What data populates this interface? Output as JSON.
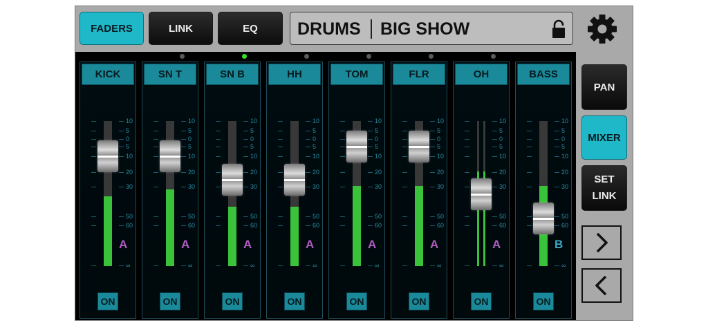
{
  "topbar": {
    "tabs": [
      {
        "label": "FADERS",
        "active": true
      },
      {
        "label": "LINK",
        "active": false
      },
      {
        "label": "EQ",
        "active": false
      }
    ],
    "group_name": "DRUMS",
    "show_name": "BIG SHOW"
  },
  "scale_labels": [
    "10",
    "5",
    "0",
    "5",
    "10",
    "20",
    "30",
    "50",
    "60",
    "∞"
  ],
  "channels": [
    {
      "name": "KICK",
      "group": "A",
      "on_label": "ON",
      "fader_db": -10,
      "meter": 0.48,
      "selected": false,
      "stereo": false
    },
    {
      "name": "SN T",
      "group": "A",
      "on_label": "ON",
      "fader_db": -10,
      "meter": 0.53,
      "selected": true,
      "stereo": false
    },
    {
      "name": "SN B",
      "group": "A",
      "on_label": "ON",
      "fader_db": -25,
      "meter": 0.41,
      "selected": false,
      "stereo": false
    },
    {
      "name": "HH",
      "group": "A",
      "on_label": "ON",
      "fader_db": -25,
      "meter": 0.41,
      "selected": false,
      "stereo": false
    },
    {
      "name": "TOM",
      "group": "A",
      "on_label": "ON",
      "fader_db": -5,
      "meter": 0.55,
      "selected": false,
      "stereo": false
    },
    {
      "name": "FLR",
      "group": "A",
      "on_label": "ON",
      "fader_db": -5,
      "meter": 0.55,
      "selected": false,
      "stereo": false
    },
    {
      "name": "OH",
      "group": "A",
      "on_label": "ON",
      "fader_db": -35,
      "meter": 0.65,
      "selected": false,
      "stereo": true
    },
    {
      "name": "BASS",
      "group": "B",
      "on_label": "ON",
      "fader_db": -52,
      "meter": 0.55,
      "selected": false,
      "stereo": false
    }
  ],
  "side_buttons": [
    {
      "label": "PAN",
      "active": false
    },
    {
      "label": "MIXER",
      "active": true
    },
    {
      "label": "SET LINK",
      "active": false
    }
  ],
  "colors": {
    "accent": "#1fb8c9",
    "channel_header": "#1a8a9a",
    "meter_green": "#3bc23b",
    "group_a": "#b15cc2",
    "group_b": "#3aa8c8",
    "selected_dot": "#39e02b",
    "idle_dot": "#5a5a5a"
  }
}
